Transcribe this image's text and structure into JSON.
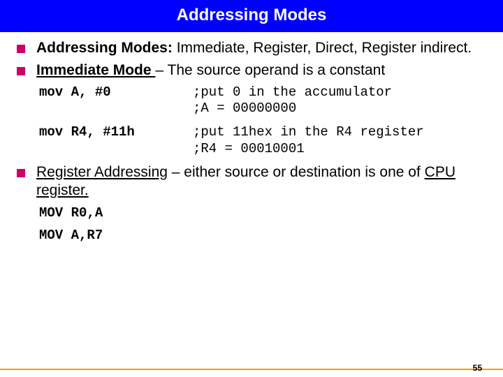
{
  "header": {
    "title": "Addressing Modes"
  },
  "bullets": {
    "b1": {
      "lead": "Addressing Modes:",
      "rest": " Immediate, Register, Direct, Register indirect."
    },
    "b2": {
      "lead": "Immediate Mode ",
      "rest": "– The source operand is a constant"
    },
    "b3": {
      "lead": "Register Addressing",
      "rest": " – either source or destination is one of ",
      "tail": "CPU register."
    }
  },
  "code": {
    "r1a": "mov A, #0",
    "r1b": ";put 0 in the accumulator",
    "r1c": ";A = 00000000",
    "r2a": "mov R4, #11h",
    "r2b": ";put 11hex in the R4 register",
    "r2c": ";R4 = 00010001"
  },
  "examples": {
    "e1": "MOV R0,A",
    "e2": "MOV A,R7"
  },
  "page": "55"
}
